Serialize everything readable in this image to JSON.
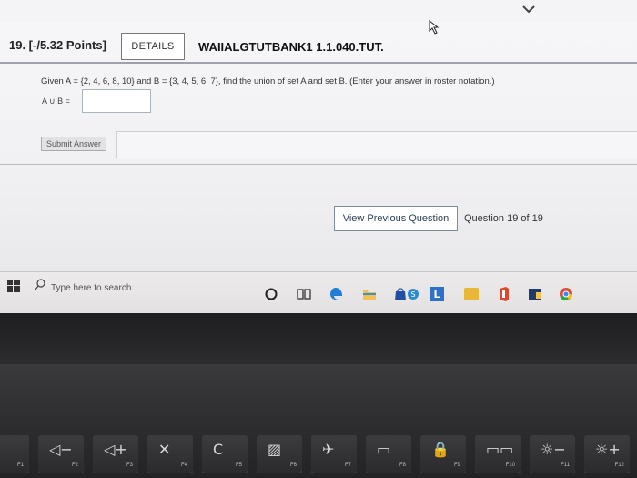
{
  "question": {
    "number_points": "19. [-/5.32 Points]",
    "details_label": "DETAILS",
    "code": "WAIIALGTUTBANK1 1.1.040.TUT.",
    "text": "Given A = {2, 4, 6, 8, 10} and B = {3, 4, 5, 6, 7}, find the union of set A and set B. (Enter your answer in roster notation.)",
    "answer_label": "A ∪ B =",
    "answer_value": "",
    "submit_label": "Submit Answer"
  },
  "navigation": {
    "view_previous_label": "View Previous Question",
    "counter": "Question 19 of 19"
  },
  "taskbar": {
    "search_placeholder": "Type here to search",
    "icons": [
      "windows-start-icon",
      "search-icon",
      "cortana-icon",
      "task-view-icon",
      "edge-icon",
      "file-explorer-icon",
      "store-icon",
      "skype-icon",
      "app-l-icon",
      "app-yellow-icon",
      "office-icon",
      "app-icon",
      "chrome-icon"
    ]
  },
  "keyboard": {
    "keys": [
      {
        "glyph": "⁄",
        "label": "F1"
      },
      {
        "glyph": "◁−",
        "label": "F2"
      },
      {
        "glyph": "◁+",
        "label": "F3"
      },
      {
        "glyph": "✕",
        "label": "F4"
      },
      {
        "glyph": "C",
        "label": "F5"
      },
      {
        "glyph": "▨",
        "label": "F6"
      },
      {
        "glyph": "✈",
        "label": "F7"
      },
      {
        "glyph": "▭",
        "label": "F8"
      },
      {
        "glyph": "🔒",
        "label": "F9"
      },
      {
        "glyph": "▭▭",
        "label": "F10"
      },
      {
        "glyph": "☼−",
        "label": "F11"
      },
      {
        "glyph": "☼+",
        "label": "F12"
      }
    ]
  },
  "colors": {
    "page_background": "#f4f4f6",
    "accent": "#2d3f55",
    "taskbar": "#e8e6e7"
  }
}
